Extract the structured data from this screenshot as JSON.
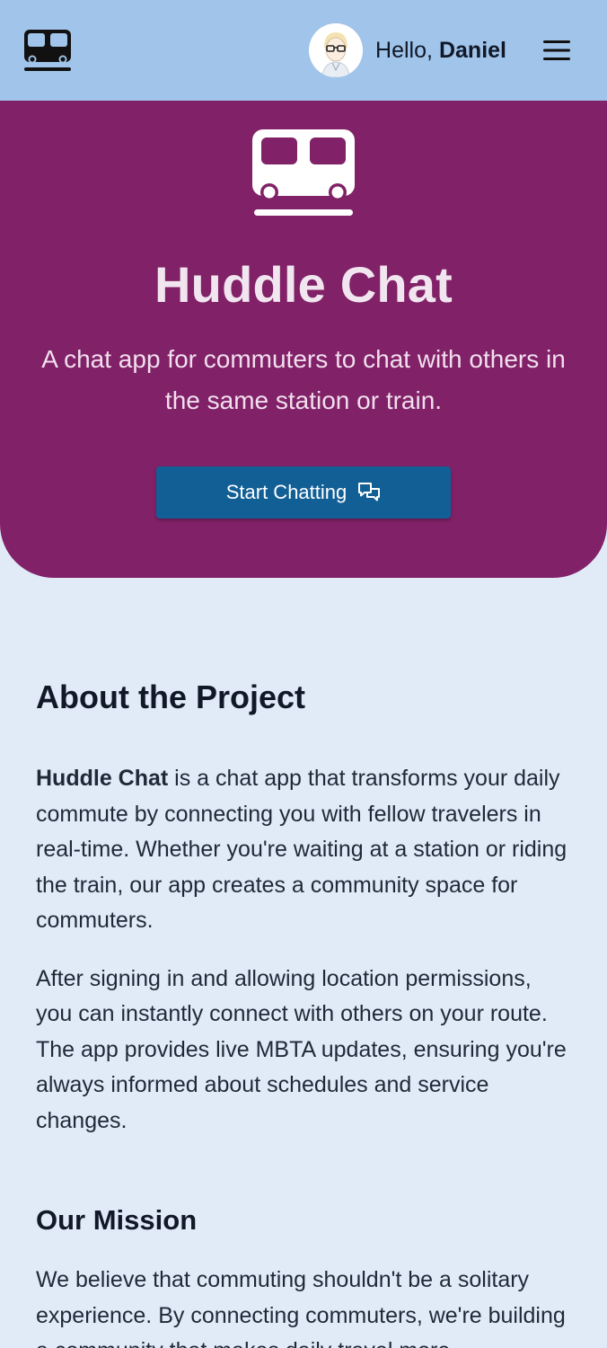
{
  "header": {
    "logo_icon": "train-icon",
    "greeting_prefix": "Hello,",
    "user_name": "Daniel",
    "menu_icon": "hamburger-menu-icon",
    "background": "#a0c4ea"
  },
  "hero": {
    "icon": "train-icon",
    "title": "Huddle Chat",
    "subtitle": "A chat app for commuters to chat with others in the same station or train.",
    "cta_label": "Start Chatting",
    "cta_icon": "chat-bubbles-icon",
    "background": "#812167",
    "button_color": "#125f96"
  },
  "about": {
    "heading": "About the Project",
    "p1_bold": "Huddle Chat",
    "p1_rest": " is a chat app that transforms your daily commute by connecting you with fellow travelers in real-time. Whether you're waiting at a station or riding the train, our app creates a community space for commuters.",
    "p2": "After signing in and allowing location permissions, you can instantly connect with others on your route. The app provides live MBTA updates, ensuring you're always informed about schedules and service changes."
  },
  "mission": {
    "heading": "Our Mission",
    "p1": "We believe that commuting shouldn't be a solitary experience. By connecting commuters, we're building a community that makes daily travel more"
  }
}
